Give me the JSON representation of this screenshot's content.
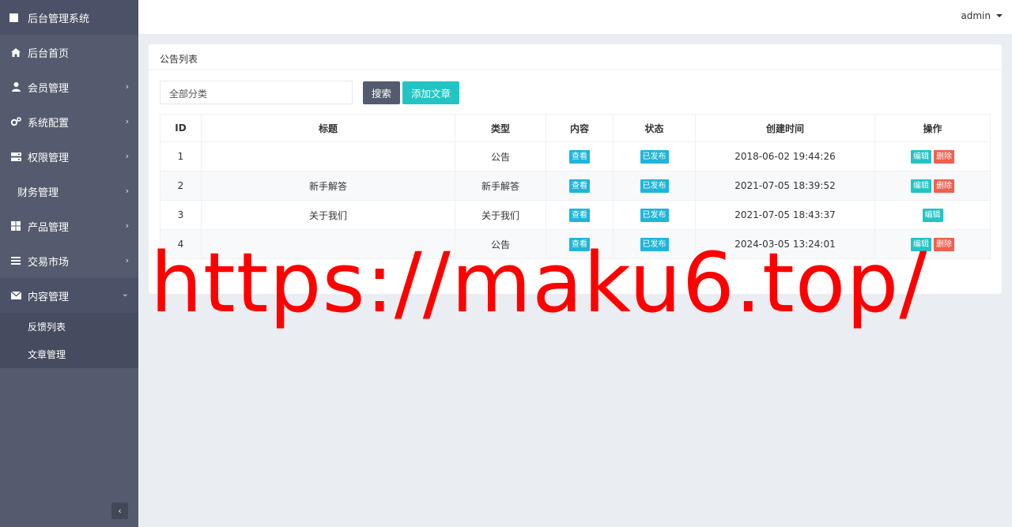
{
  "brand": {
    "title": "后台管理系统"
  },
  "nav": [
    {
      "label": "后台首页",
      "icon": "home-icon",
      "chevron": false
    },
    {
      "label": "会员管理",
      "icon": "user-icon",
      "chevron": true
    },
    {
      "label": "系统配置",
      "icon": "cogs-icon",
      "chevron": true
    },
    {
      "label": "权限管理",
      "icon": "server-icon",
      "chevron": true
    },
    {
      "label": "财务管理",
      "icon": "",
      "chevron": true
    },
    {
      "label": "产品管理",
      "icon": "windows-icon",
      "chevron": true
    },
    {
      "label": "交易市场",
      "icon": "list-icon",
      "chevron": true
    },
    {
      "label": "内容管理",
      "icon": "envelope-icon",
      "chevron": true,
      "expanded": true
    }
  ],
  "subnav": [
    {
      "label": "反馈列表"
    },
    {
      "label": "文章管理"
    }
  ],
  "user": {
    "name": "admin"
  },
  "panel": {
    "title": "公告列表",
    "filter_value": "全部分类",
    "search_label": "搜索",
    "add_label": "添加文章"
  },
  "table": {
    "headers": [
      "ID",
      "标题",
      "类型",
      "内容",
      "状态",
      "创建时间",
      "操作"
    ],
    "rows": [
      {
        "id": "1",
        "title": "",
        "type": "公告",
        "content": "查看",
        "status": "已发布",
        "created": "2018-06-02 19:44:26",
        "actions": [
          "编辑",
          "删除"
        ]
      },
      {
        "id": "2",
        "title": "新手解答",
        "type": "新手解答",
        "content": "查看",
        "status": "已发布",
        "created": "2021-07-05 18:39:52",
        "actions": [
          "编辑",
          "删除"
        ]
      },
      {
        "id": "3",
        "title": "关于我们",
        "type": "关于我们",
        "content": "查看",
        "status": "已发布",
        "created": "2021-07-05 18:43:37",
        "actions": [
          "编辑"
        ]
      },
      {
        "id": "4",
        "title": "",
        "type": "公告",
        "content": "查看",
        "status": "已发布",
        "created": "2024-03-05 13:24:01",
        "actions": [
          "编辑",
          "删除"
        ]
      }
    ]
  },
  "watermark": "https://maku6.top/",
  "colors": {
    "sidebar": "#545b6e",
    "teal": "#22c4c4",
    "cyan": "#1fb5d9",
    "red": "#f0604f"
  }
}
